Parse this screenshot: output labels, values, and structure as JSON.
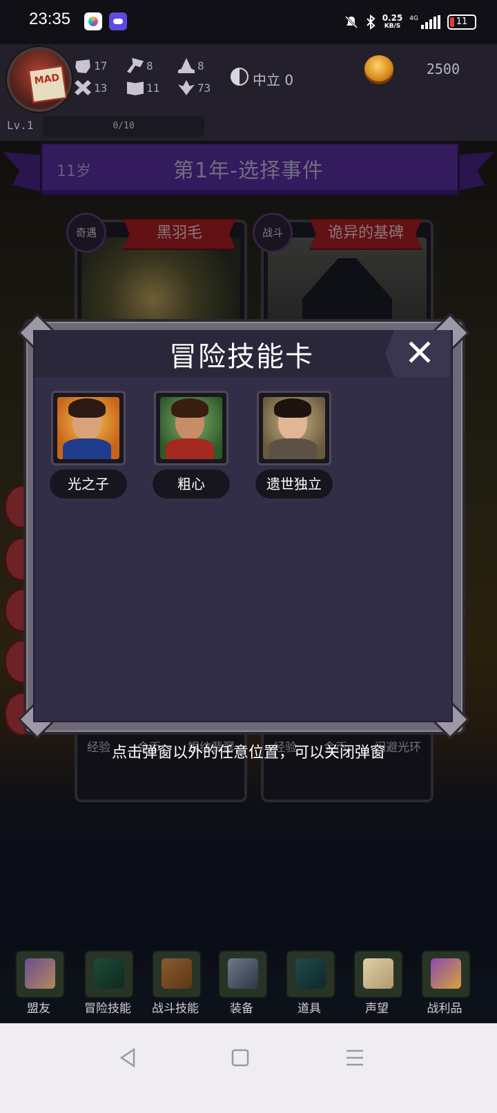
{
  "status_bar": {
    "time": "23:35",
    "net_speed_value": "0.25",
    "net_speed_unit": "KB/S",
    "signal_type": "4G",
    "battery": "11"
  },
  "hud": {
    "stats": [
      {
        "icon": "fist-icon",
        "value": "17"
      },
      {
        "icon": "axe-icon",
        "value": "8"
      },
      {
        "icon": "hat-icon",
        "value": "8"
      },
      {
        "icon": "cross-icon",
        "value": "13"
      },
      {
        "icon": "book-icon",
        "value": "11"
      },
      {
        "icon": "leaf-icon",
        "value": "73"
      }
    ],
    "alignment": "中立 0",
    "avatar_tag": "MAD",
    "gold": "2500",
    "level": "Lv.1",
    "xp": "0/10",
    "xp_fraction": 0
  },
  "event_header": {
    "age": "11岁",
    "title": "第1年-选择事件"
  },
  "event_cards": [
    {
      "type": "奇遇",
      "title": "黑羽毛",
      "rewards": [
        "经验",
        "金币",
        "银纹翡翠"
      ]
    },
    {
      "type": "战斗",
      "title": "诡异的基碑",
      "rewards": [
        "经验",
        "金币",
        "闪避光环"
      ]
    }
  ],
  "modal": {
    "title": "冒险技能卡",
    "skills": [
      {
        "label": "光之子"
      },
      {
        "label": "粗心"
      },
      {
        "label": "遗世独立"
      }
    ]
  },
  "hint": "点击弹窗以外的任意位置，可以关闭弹窗",
  "bottom_nav": [
    {
      "label": "盟友",
      "icon": "handshake-icon"
    },
    {
      "label": "冒险技能",
      "icon": "spellbook-icon"
    },
    {
      "label": "战斗技能",
      "icon": "backpack-icon"
    },
    {
      "label": "装备",
      "icon": "crossed-swords-icon"
    },
    {
      "label": "道具",
      "icon": "pouch-icon"
    },
    {
      "label": "声望",
      "icon": "scroll-icon"
    },
    {
      "label": "战利品",
      "icon": "treasure-chest-icon"
    }
  ],
  "colors": {
    "banner": "#5a2ea0",
    "ribbon": "#b01d1d",
    "modal_bg": "#332e48"
  }
}
